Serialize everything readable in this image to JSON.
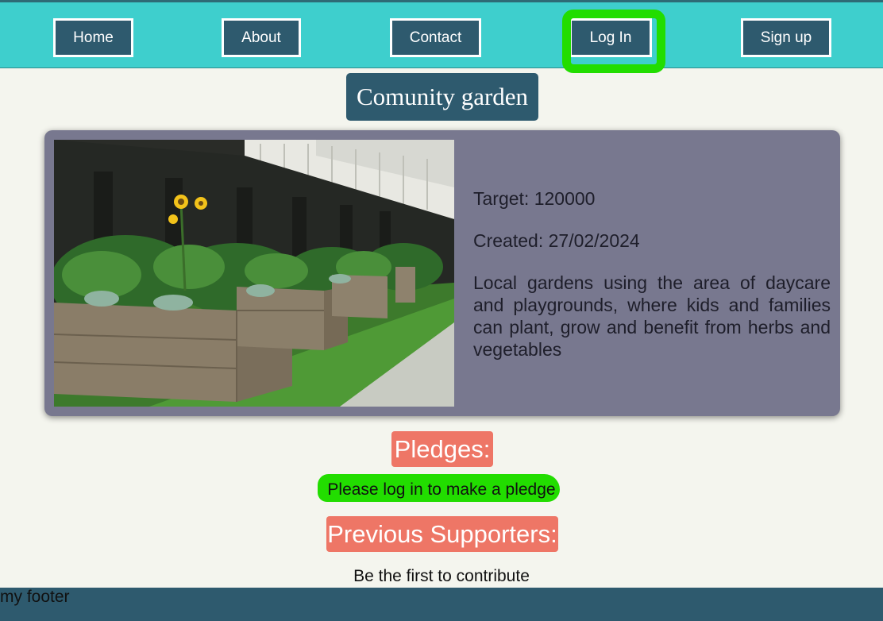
{
  "nav": {
    "items": [
      {
        "label": "Home"
      },
      {
        "label": "About"
      },
      {
        "label": "Contact"
      },
      {
        "label": "Log In"
      },
      {
        "label": "Sign up"
      }
    ]
  },
  "project": {
    "title": "Comunity garden",
    "target": "Target: 120000",
    "created": "Created: 27/02/2024",
    "description": "Local gardens using the area of daycare and playgrounds, where kids and families can plant, grow and benefit from herbs and vegetables"
  },
  "pledges": {
    "heading": "Pledges:",
    "message": "Please log in to make a pledge"
  },
  "supporters": {
    "heading": "Previous Supporters:",
    "message": "Be the first to contribute"
  },
  "footer": {
    "text": "my footer"
  },
  "colors": {
    "nav_bg": "#3ecfcd",
    "button_bg": "#2e5a6e",
    "card_bg": "#78788f",
    "accent_pill": "#ee7666",
    "highlight": "#22dd00"
  }
}
